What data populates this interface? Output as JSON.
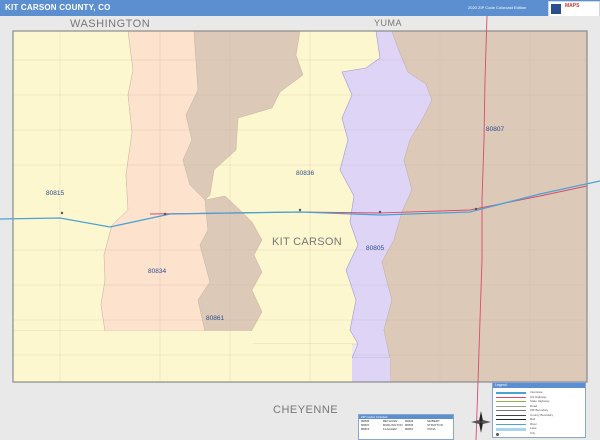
{
  "header": {
    "title": "KIT CARSON COUNTY, CO",
    "edition": "2020 ZIP Code Colorcast Edition",
    "logo_text": "MAPS"
  },
  "map": {
    "county_name": "KIT CARSON",
    "neighbors": {
      "north_west": "WASHINGTON",
      "north_east": "YUMA",
      "south": "CHEYENNE"
    },
    "zip_codes": [
      "80815",
      "80834",
      "80861",
      "80836",
      "80805",
      "80807"
    ],
    "colors": {
      "80815": "#fdf7d0",
      "80834": "#fde2cd",
      "80861": "#ddc9b8",
      "80836": "#fdf7d0",
      "80805": "#ddd4f6",
      "80807": "#ddc9b8",
      "outside": "#e9e9ea",
      "road_interstate": "#4aa3d4",
      "road_us": "#d94c6a",
      "header": "#5b8fd0"
    }
  },
  "legend": {
    "title": "Legend",
    "items": [
      "Interstate",
      "US Highway",
      "State Highway",
      "Road",
      "ZIP Boundary",
      "County Boundary",
      "Rail",
      "River",
      "Lake",
      "City"
    ]
  },
  "zip_table": {
    "title": "ZIP Codes Included",
    "rows": [
      [
        "80805",
        "BETHUNE",
        "80834",
        "SEIBERT"
      ],
      [
        "80807",
        "BURLINGTON",
        "80836",
        "STRATTON"
      ],
      [
        "80815",
        "FLAGLER",
        "80861",
        "VONA"
      ]
    ]
  }
}
